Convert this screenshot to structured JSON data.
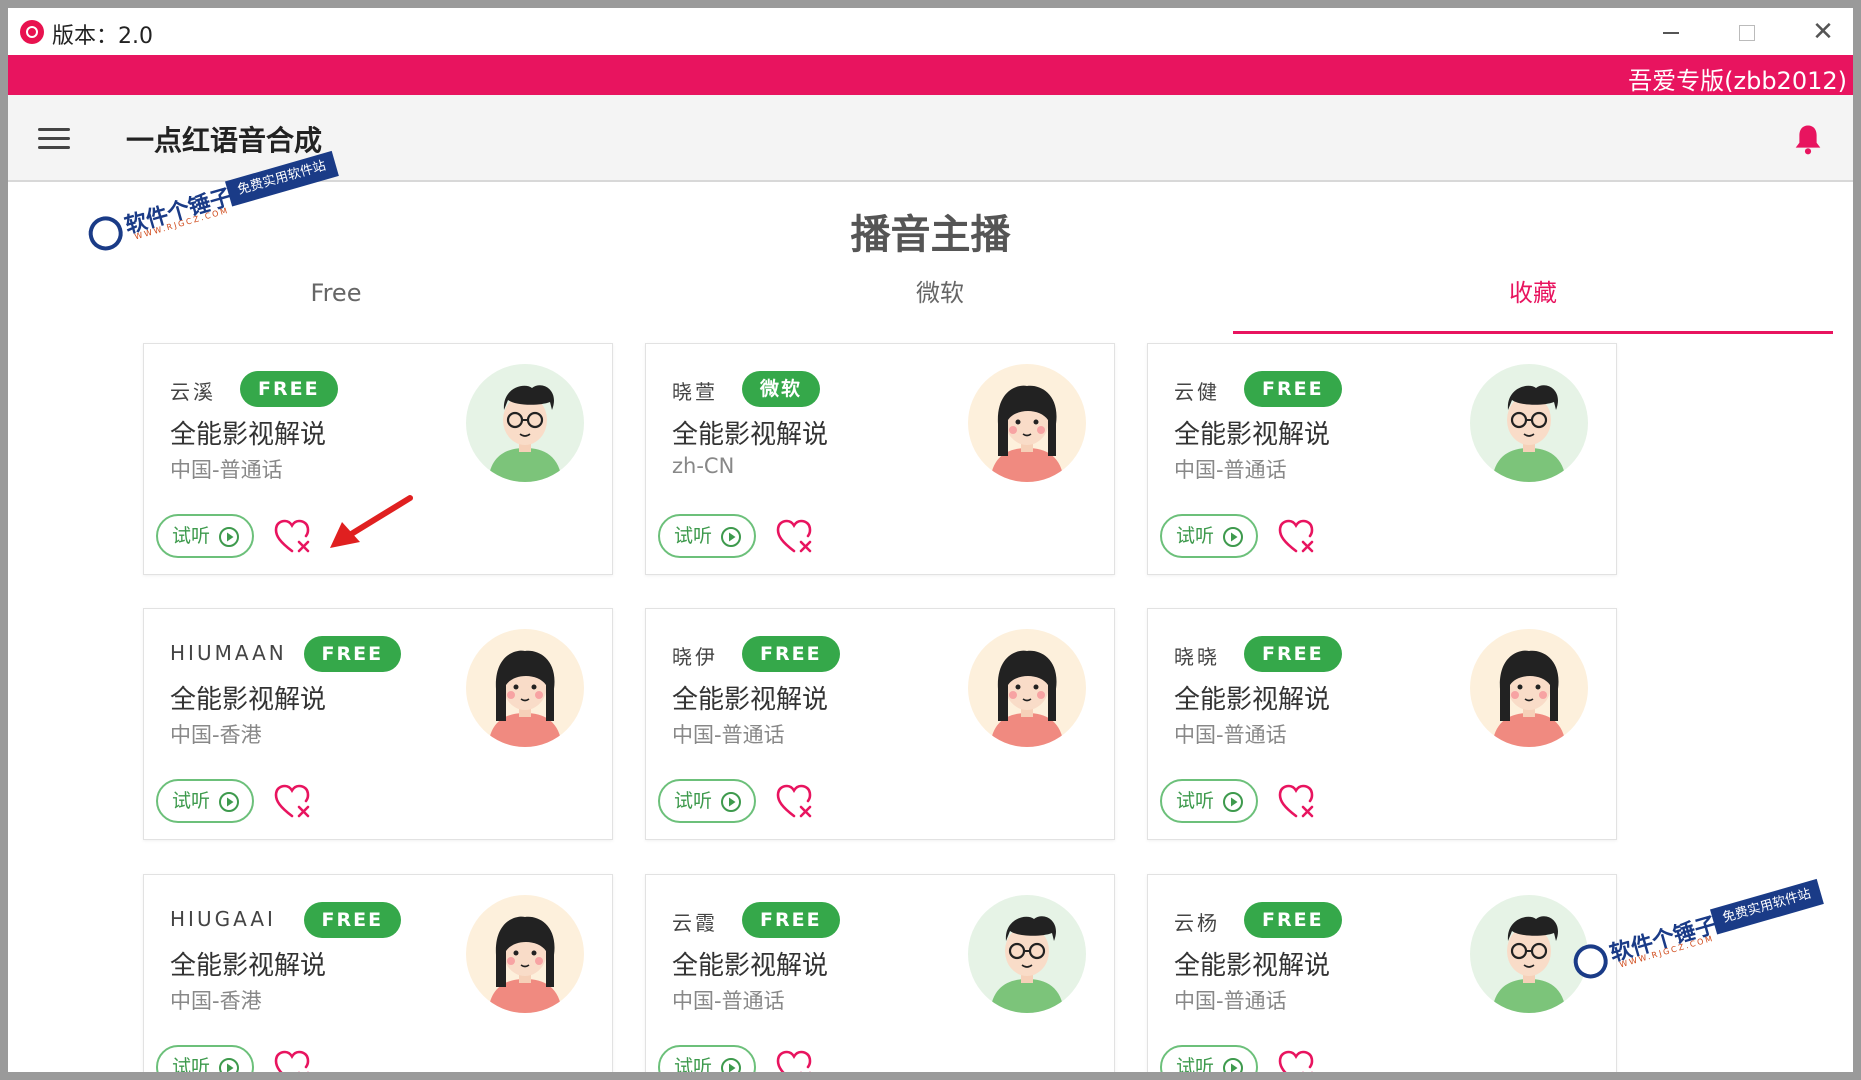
{
  "window": {
    "title": "版本：2.0",
    "controls": {
      "minimize": "minimize",
      "maximize": "maximize",
      "close": "✕"
    }
  },
  "banner": {
    "text": "吾爱专版(zbb2012)"
  },
  "appbar": {
    "title": "一点红语音合成"
  },
  "section": {
    "title": "播音主播"
  },
  "tabs": [
    {
      "label": "Free",
      "active": false
    },
    {
      "label": "微软",
      "active": false
    },
    {
      "label": "收藏",
      "active": true
    }
  ],
  "watermark": {
    "main": "软件个锤子",
    "sub": "WWW.RJGCZ.COM",
    "tag": "免费实用软件站"
  },
  "colors": {
    "accent": "#e8145f",
    "badge_green": "#35a84a",
    "listen_green": "#3e9a4d"
  },
  "cards": [
    {
      "name": "云溪",
      "badge": "FREE",
      "style": "全能影视解说",
      "lang": "中国-普通话",
      "listen": "试听",
      "avatar": "male-avatar"
    },
    {
      "name": "晓萱",
      "badge": "微软",
      "style": "全能影视解说",
      "lang": "zh-CN",
      "listen": "试听",
      "avatar": "female-avatar"
    },
    {
      "name": "云健",
      "badge": "FREE",
      "style": "全能影视解说",
      "lang": "中国-普通话",
      "listen": "试听",
      "avatar": "male-avatar"
    },
    {
      "name": "HIUMAAN",
      "badge": "FREE",
      "style": "全能影视解说",
      "lang": "中国-香港",
      "listen": "试听",
      "avatar": "female-avatar"
    },
    {
      "name": "晓伊",
      "badge": "FREE",
      "style": "全能影视解说",
      "lang": "中国-普通话",
      "listen": "试听",
      "avatar": "female-avatar"
    },
    {
      "name": "晓晓",
      "badge": "FREE",
      "style": "全能影视解说",
      "lang": "中国-普通话",
      "listen": "试听",
      "avatar": "female-avatar"
    },
    {
      "name": "HIUGAAI",
      "badge": "FREE",
      "style": "全能影视解说",
      "lang": "中国-香港",
      "listen": "试听",
      "avatar": "female-avatar"
    },
    {
      "name": "云霞",
      "badge": "FREE",
      "style": "全能影视解说",
      "lang": "中国-普通话",
      "listen": "试听",
      "avatar": "male-avatar"
    },
    {
      "name": "云杨",
      "badge": "FREE",
      "style": "全能影视解说",
      "lang": "中国-普通话",
      "listen": "试听",
      "avatar": "male-avatar"
    }
  ]
}
